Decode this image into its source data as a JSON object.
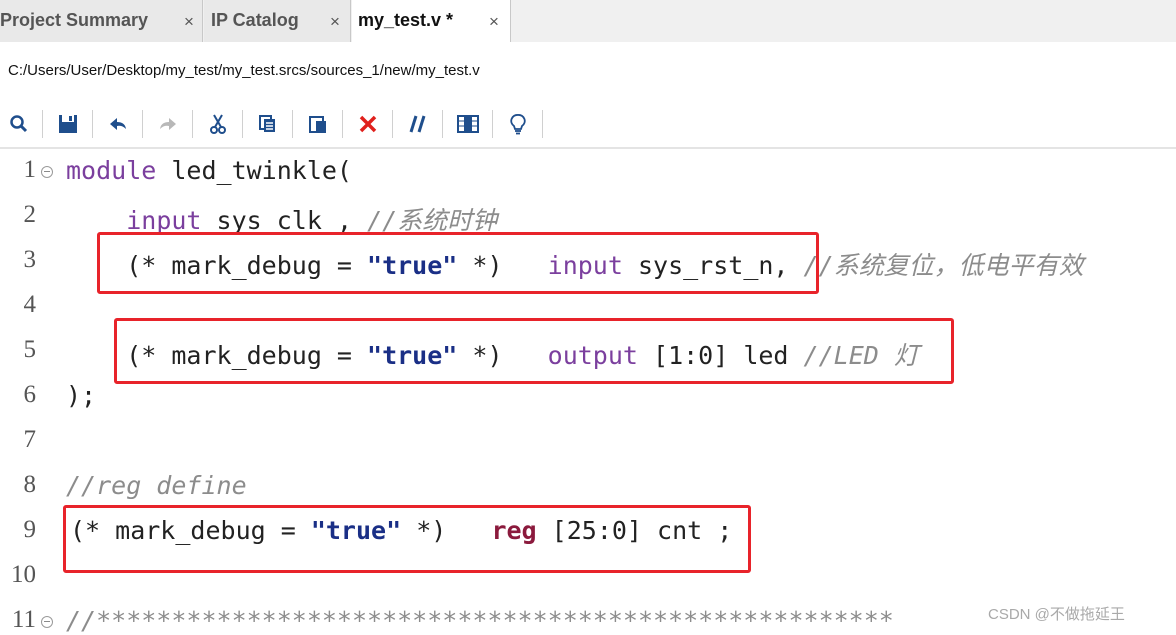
{
  "tabs": [
    {
      "label": "Project Summary",
      "close": "×",
      "active": false
    },
    {
      "label": "IP Catalog",
      "close": "×",
      "active": false
    },
    {
      "label": "my_test.v *",
      "close": "×",
      "active": true
    }
  ],
  "file_path": "C:/Users/User/Desktop/my_test/my_test.srcs/sources_1/new/my_test.v",
  "toolbar": {
    "icons": [
      "search-icon",
      "save-icon",
      "undo-icon",
      "redo-icon",
      "cut-icon",
      "copy-icon",
      "paste-icon",
      "delete-icon",
      "comment-icon",
      "column-select-icon",
      "lightbulb-icon"
    ]
  },
  "editor": {
    "line_numbers": [
      "1",
      "2",
      "3",
      "4",
      "5",
      "6",
      "7",
      "8",
      "9",
      "10",
      "11"
    ],
    "lines": [
      {
        "n": 1,
        "parts": [
          {
            "t": "module",
            "c": "kw"
          },
          {
            "t": " led_twinkle(",
            "c": ""
          }
        ]
      },
      {
        "n": 2,
        "parts": [
          {
            "t": "    ",
            "c": ""
          },
          {
            "t": "input",
            "c": "kw"
          },
          {
            "t": " sys_clk , ",
            "c": ""
          },
          {
            "t": "//系统时钟",
            "c": "cmt"
          }
        ]
      },
      {
        "n": 3,
        "parts": [
          {
            "t": "    (* mark_debug = ",
            "c": ""
          },
          {
            "t": "\"true\"",
            "c": "str"
          },
          {
            "t": " *)   ",
            "c": ""
          },
          {
            "t": "input",
            "c": "kw"
          },
          {
            "t": " sys_rst_n, ",
            "c": ""
          },
          {
            "t": "//系统复位，低电平有效",
            "c": "cmt"
          }
        ]
      },
      {
        "n": 4,
        "parts": []
      },
      {
        "n": 5,
        "parts": [
          {
            "t": "    (* mark_debug = ",
            "c": ""
          },
          {
            "t": "\"true\"",
            "c": "str"
          },
          {
            "t": " *)   ",
            "c": ""
          },
          {
            "t": "output",
            "c": "kw"
          },
          {
            "t": " [1:0] led ",
            "c": ""
          },
          {
            "t": "//LED 灯",
            "c": "cmt"
          }
        ]
      },
      {
        "n": 6,
        "parts": [
          {
            "t": ");",
            "c": ""
          }
        ]
      },
      {
        "n": 7,
        "parts": []
      },
      {
        "n": 8,
        "parts": [
          {
            "t": "//reg define",
            "c": "cmt"
          }
        ]
      },
      {
        "n": 9,
        "parts": [
          {
            "t": "(* mark_debug = ",
            "c": ""
          },
          {
            "t": "\"true\"",
            "c": "str"
          },
          {
            "t": " *)   ",
            "c": ""
          },
          {
            "t": "reg",
            "c": "kw-strong"
          },
          {
            "t": " [25:0] cnt ;",
            "c": ""
          }
        ]
      },
      {
        "n": 10,
        "parts": []
      },
      {
        "n": 11,
        "parts": [
          {
            "t": "//*****************************************************",
            "c": "cmt"
          }
        ]
      }
    ]
  },
  "watermark": "CSDN @不做拖延王",
  "colors": {
    "keyword": "#7b3f9e",
    "keyword_reg": "#8b1a3d",
    "string": "#1a2f86",
    "comment": "#8c8c8c",
    "highlight_box": "#e8232a"
  }
}
